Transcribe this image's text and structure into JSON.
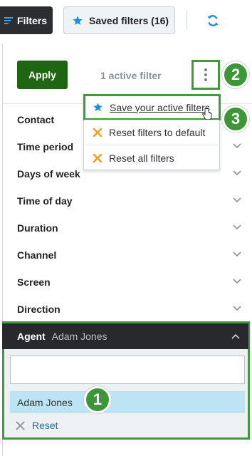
{
  "toolbar": {
    "filters_label": "Filters",
    "saved_filters_label": "Saved filters (16)"
  },
  "panel": {
    "apply_label": "Apply",
    "active_filter_text": "1 active filter"
  },
  "menu": {
    "items": [
      {
        "label": "Save your active filters",
        "icon": "star-icon",
        "color": "#1e90d6"
      },
      {
        "label": "Reset filters to default",
        "icon": "x-icon",
        "color": "#f0a020"
      },
      {
        "label": "Reset all filters",
        "icon": "x-icon",
        "color": "#f0a020"
      }
    ]
  },
  "filter_rows": [
    "Contact",
    "Time period",
    "Days of week",
    "Time of day",
    "Duration",
    "Channel",
    "Screen",
    "Direction"
  ],
  "agent": {
    "label": "Agent",
    "value": "Adam Jones",
    "search_value": "",
    "options": [
      "Adam Jones"
    ],
    "reset_label": "Reset"
  },
  "callouts": [
    "1",
    "2",
    "3"
  ],
  "colors": {
    "accent_green": "#3f9b3a",
    "apply_green": "#1f6613",
    "star_blue": "#1e90d6",
    "reset_orange": "#f0a020",
    "selected_option": "#bde4f5"
  }
}
